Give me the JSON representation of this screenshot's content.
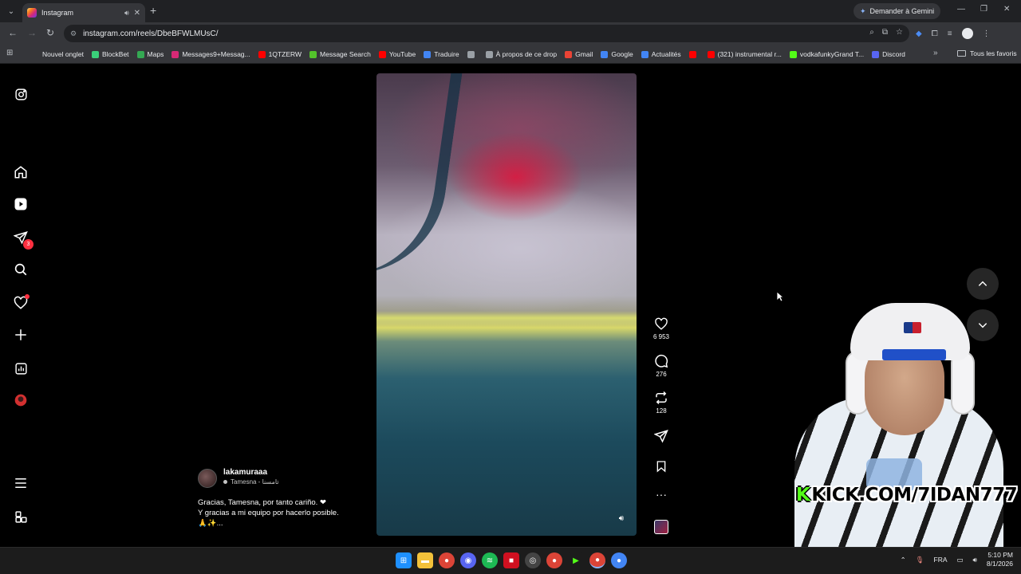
{
  "browser": {
    "tab": {
      "title": "Instagram"
    },
    "gemini_label": "Demander à Gemini",
    "url": "instagram.com/reels/DbeBFWLMUsC/",
    "bookmarks": [
      {
        "label": "Nouvel onglet",
        "color": "#00000000"
      },
      {
        "label": "BlockBet",
        "color": "#3ad07a"
      },
      {
        "label": "Maps",
        "color": "#34a853"
      },
      {
        "label": "Messages9+Messag...",
        "color": "#d62976"
      },
      {
        "label": "1QTZERW",
        "color": "#ff0000"
      },
      {
        "label": "Message Search",
        "color": "#53c22b"
      },
      {
        "label": "YouTube",
        "color": "#ff0000"
      },
      {
        "label": "Traduire",
        "color": "#4285f4"
      },
      {
        "label": "",
        "color": "#9aa0a6"
      },
      {
        "label": "À propos de ce drop",
        "color": "#9aa0a6"
      },
      {
        "label": "Gmail",
        "color": "#ea4335"
      },
      {
        "label": "Google",
        "color": "#4285f4"
      },
      {
        "label": "Actualités",
        "color": "#4285f4"
      },
      {
        "label": "",
        "color": "#ff0000"
      },
      {
        "label": "(321) instrumental r...",
        "color": "#ff0000"
      },
      {
        "label": "vodkafunkyGrand T...",
        "color": "#53fc18"
      },
      {
        "label": "Discord",
        "color": "#5865f2"
      }
    ],
    "all_bookmarks": "Tous les favoris"
  },
  "sidebar": {
    "messages_badge": "3"
  },
  "reel": {
    "username": "lakamuraaa",
    "location": "Tamesna - تامسنا",
    "caption": "Gracias, Tamesna, por tanto cariño. ❤\nY gracias a mi equipo por hacerlo posible.\n🙏✨...",
    "likes": "6 953",
    "comments": "276",
    "reposts": "128"
  },
  "overlay": {
    "kick_text": "KICK.COM/7IDAN777"
  },
  "taskbar": {
    "language": "FRA",
    "time": "5:10 PM",
    "date": "8/1/2026"
  },
  "colors": {
    "accent_red": "#ff3040",
    "kick_green": "#53fc18"
  }
}
